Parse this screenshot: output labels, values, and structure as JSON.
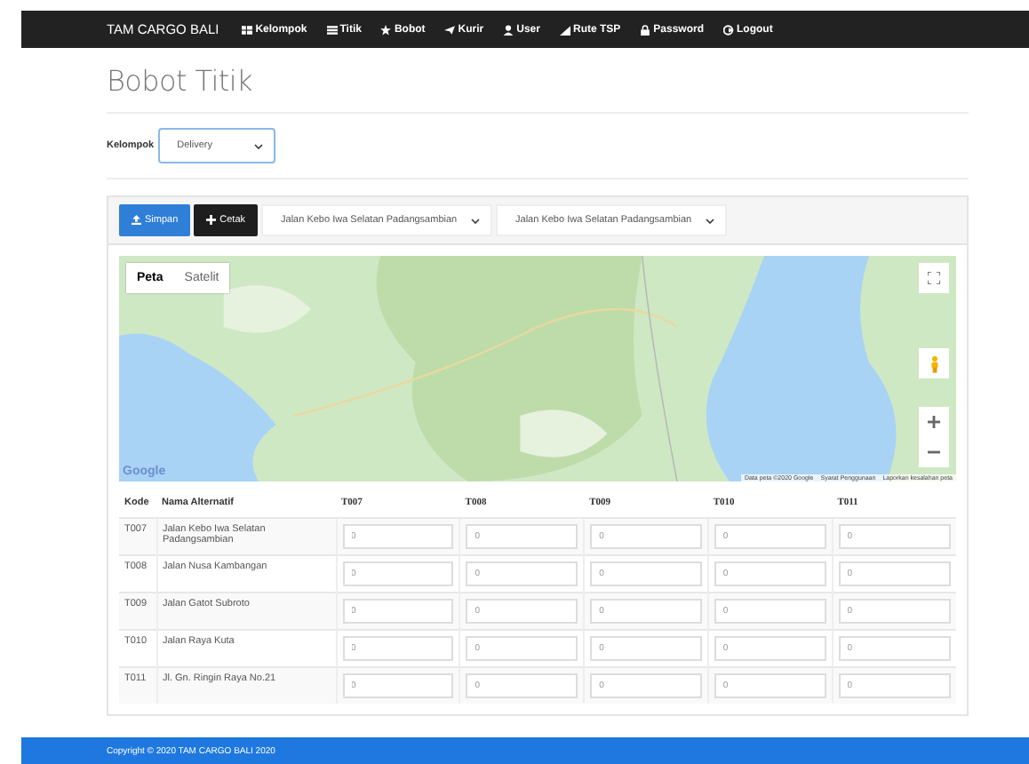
{
  "navbar": {
    "brand": "TAM CARGO BALI",
    "items": [
      {
        "label": "Kelompok",
        "kind": "grid"
      },
      {
        "label": "Titik",
        "kind": "list"
      },
      {
        "label": "Bobot",
        "kind": "star"
      },
      {
        "label": "Kurir",
        "kind": "send"
      },
      {
        "label": "User",
        "kind": "user"
      },
      {
        "label": "Rute TSP",
        "kind": "signal"
      },
      {
        "label": "Password",
        "kind": "lock"
      },
      {
        "label": "Logout",
        "kind": "logout"
      }
    ]
  },
  "title": "Bobot Titik",
  "kelompok": {
    "label": "Kelompok",
    "value": "Delivery"
  },
  "toolbar": {
    "buttons": [
      {
        "label": "Simpan",
        "kind": "primary"
      },
      {
        "label": "Cetak",
        "kind": "dark"
      }
    ],
    "selects": [
      "Jalan Kebo Iwa Selatan Padangsambian",
      "Jalan Kebo Iwa Selatan Padangsambian"
    ]
  },
  "map": {
    "tabs": [
      {
        "label": "Peta",
        "selected": true
      },
      {
        "label": "Satelit",
        "selected": false
      }
    ],
    "logo": "Google",
    "attribution": [
      "Data peta ©2020 Google",
      "Syarat Penggunaan",
      "Laporkan kesalahan peta"
    ]
  },
  "table": {
    "columns": [
      "Kode",
      "Nama Alternatif",
      "T007",
      "T008",
      "T009",
      "T010",
      "T011"
    ],
    "rows": [
      {
        "kode": "T007",
        "nama": "Jalan Kebo Iwa Selatan Padangsambian",
        "placeholders": [
          "0",
          "0",
          "0",
          "0",
          "0"
        ]
      },
      {
        "kode": "T008",
        "nama": "Jalan Nusa Kambangan",
        "placeholders": [
          "0",
          "0",
          "0",
          "0",
          "0"
        ]
      },
      {
        "kode": "T009",
        "nama": "Jalan Gatot Subroto",
        "placeholders": [
          "0",
          "0",
          "0",
          "0",
          "0"
        ]
      },
      {
        "kode": "T010",
        "nama": "Jalan Raya Kuta",
        "placeholders": [
          "0",
          "0",
          "0",
          "0",
          "0"
        ]
      },
      {
        "kode": "T011",
        "nama": "Jl. Gn. Ringin Raya No.21",
        "placeholders": [
          "0",
          "0",
          "0",
          "0",
          "0"
        ]
      }
    ]
  },
  "footer": "Copyright © 2020 TAM CARGO BALI 2020"
}
